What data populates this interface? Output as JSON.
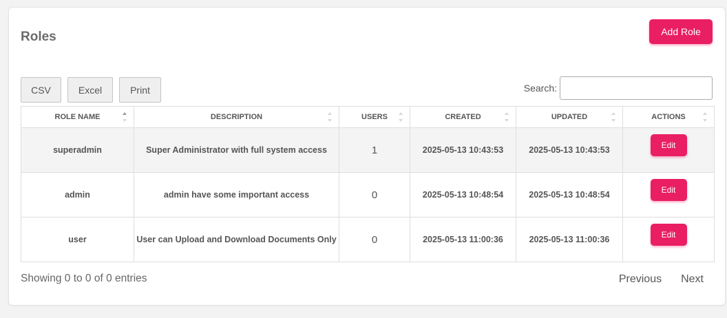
{
  "page": {
    "title": "Roles",
    "add_button": "Add Role"
  },
  "toolbar": {
    "csv": "CSV",
    "excel": "Excel",
    "print": "Print"
  },
  "search": {
    "label": "Search:",
    "value": ""
  },
  "table": {
    "columns": [
      "ROLE NAME",
      "DESCRIPTION",
      "USERS",
      "CREATED",
      "UPDATED",
      "ACTIONS"
    ],
    "rows": [
      {
        "name": "superadmin",
        "description": "Super Administrator with full system access",
        "users": "1",
        "created": "2025-05-13 10:43:53",
        "updated": "2025-05-13 10:43:53",
        "action": "Edit"
      },
      {
        "name": "admin",
        "description": "admin have some important access",
        "users": "0",
        "created": "2025-05-13 10:48:54",
        "updated": "2025-05-13 10:48:54",
        "action": "Edit"
      },
      {
        "name": "user",
        "description": "User can Upload and Download Documents Only",
        "users": "0",
        "created": "2025-05-13 11:00:36",
        "updated": "2025-05-13 11:00:36",
        "action": "Edit"
      }
    ]
  },
  "footer": {
    "info": "Showing 0 to 0 of 0 entries",
    "previous": "Previous",
    "next": "Next"
  },
  "colors": {
    "accent": "#ea1e63",
    "page_bg": "#f3f3f3",
    "highlight_row": "#f4f4f4"
  },
  "icons": {
    "sort": "sort-arrows-icon"
  }
}
